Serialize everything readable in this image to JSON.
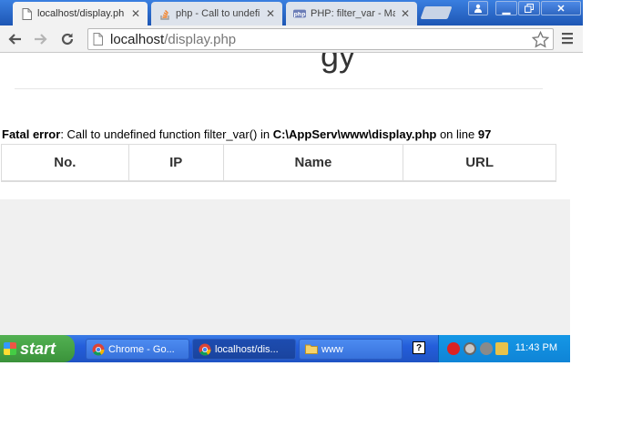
{
  "browser": {
    "tabs": [
      {
        "title": "localhost/display.ph",
        "active": true
      },
      {
        "title": "php - Call to undefin",
        "active": false
      },
      {
        "title": "PHP: filter_var - Ma",
        "active": false
      }
    ],
    "url_host": "localhost",
    "url_path": "/display.php"
  },
  "page": {
    "cut_heading": "gy",
    "error": {
      "label": "Fatal error",
      "message": ": Call to undefined function filter_var() in ",
      "path": "C:\\AppServ\\www\\display.php",
      "on_line_text": " on line ",
      "line": "97"
    },
    "table": {
      "headers": [
        "No.",
        "IP",
        "Name",
        "URL"
      ]
    }
  },
  "taskbar": {
    "start_label": "start",
    "tasks": [
      {
        "label": "Chrome - Go...",
        "active": false
      },
      {
        "label": "localhost/dis...",
        "active": true
      },
      {
        "label": "www",
        "active": false
      }
    ],
    "help_label": "?",
    "clock": "11:43 PM"
  },
  "colors": {
    "chrome_blue": "#1d56b4",
    "taskbar_blue": "#245edb",
    "start_green": "#3a923a",
    "tray_blue": "#0f84d6"
  }
}
